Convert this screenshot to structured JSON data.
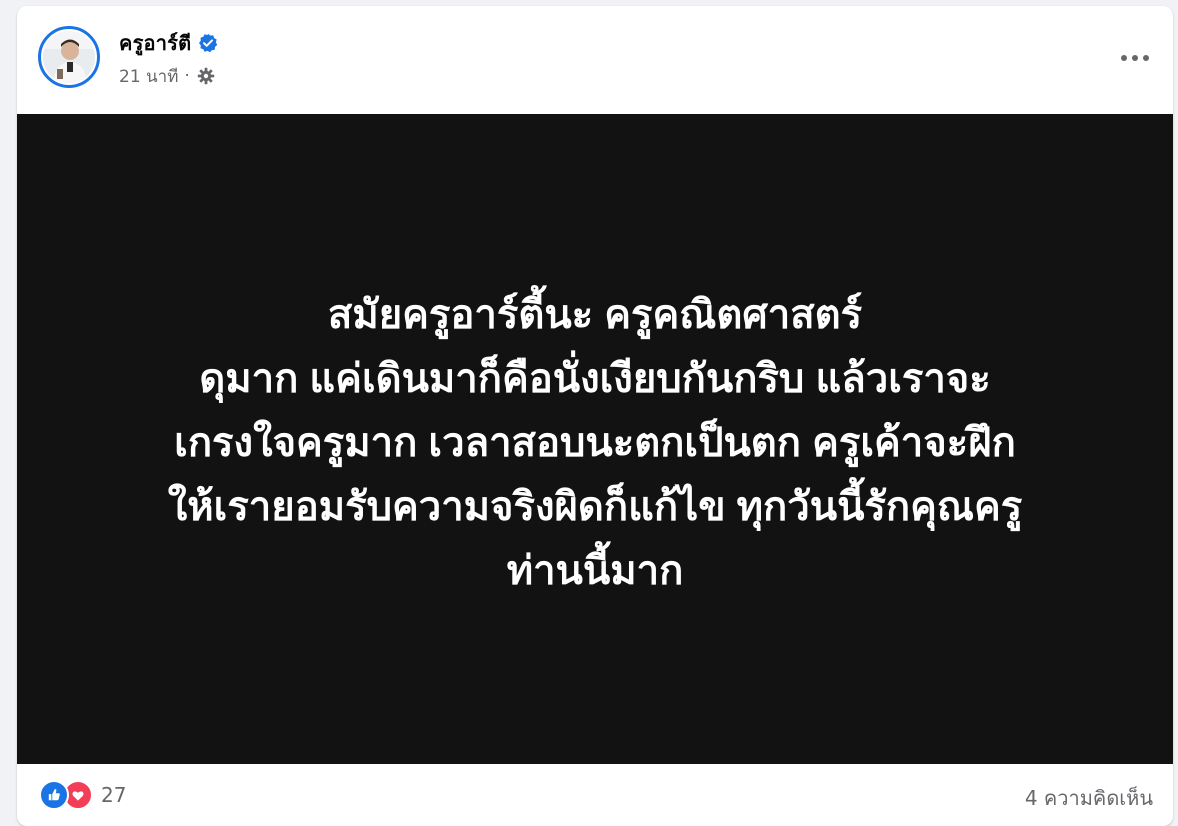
{
  "post": {
    "author_name": "ครูอาร์ตี",
    "verified": true,
    "timestamp": "21 นาที",
    "meta_separator": "·",
    "privacy_icon": "gear-icon",
    "more_icon": "more-horizontal-icon",
    "body_text": "สมัยครูอาร์ตี้นะ ครูคณิตศาสตร์\nดุมาก แค่เดินมาก็คือนั่งเงียบกันกริบ แล้วเราจะ\nเกรงใจครูมาก เวลาสอบนะตกเป็นตก ครูเค้าจะฝึก\nให้เรายอมรับความจริงผิดก็แก้ไข ทุกวันนี้รักคุณครู\nท่านนี้มาก",
    "background_color": "#121212",
    "text_color": "#ffffff"
  },
  "footer": {
    "reaction_icons": [
      "like-icon",
      "love-icon"
    ],
    "reaction_count": "27",
    "comments_label": "4 ความคิดเห็น"
  },
  "colors": {
    "accent": "#1b74e4",
    "love": "#f33e58",
    "secondary_text": "#65676b",
    "page_bg": "#f0f2f5"
  }
}
